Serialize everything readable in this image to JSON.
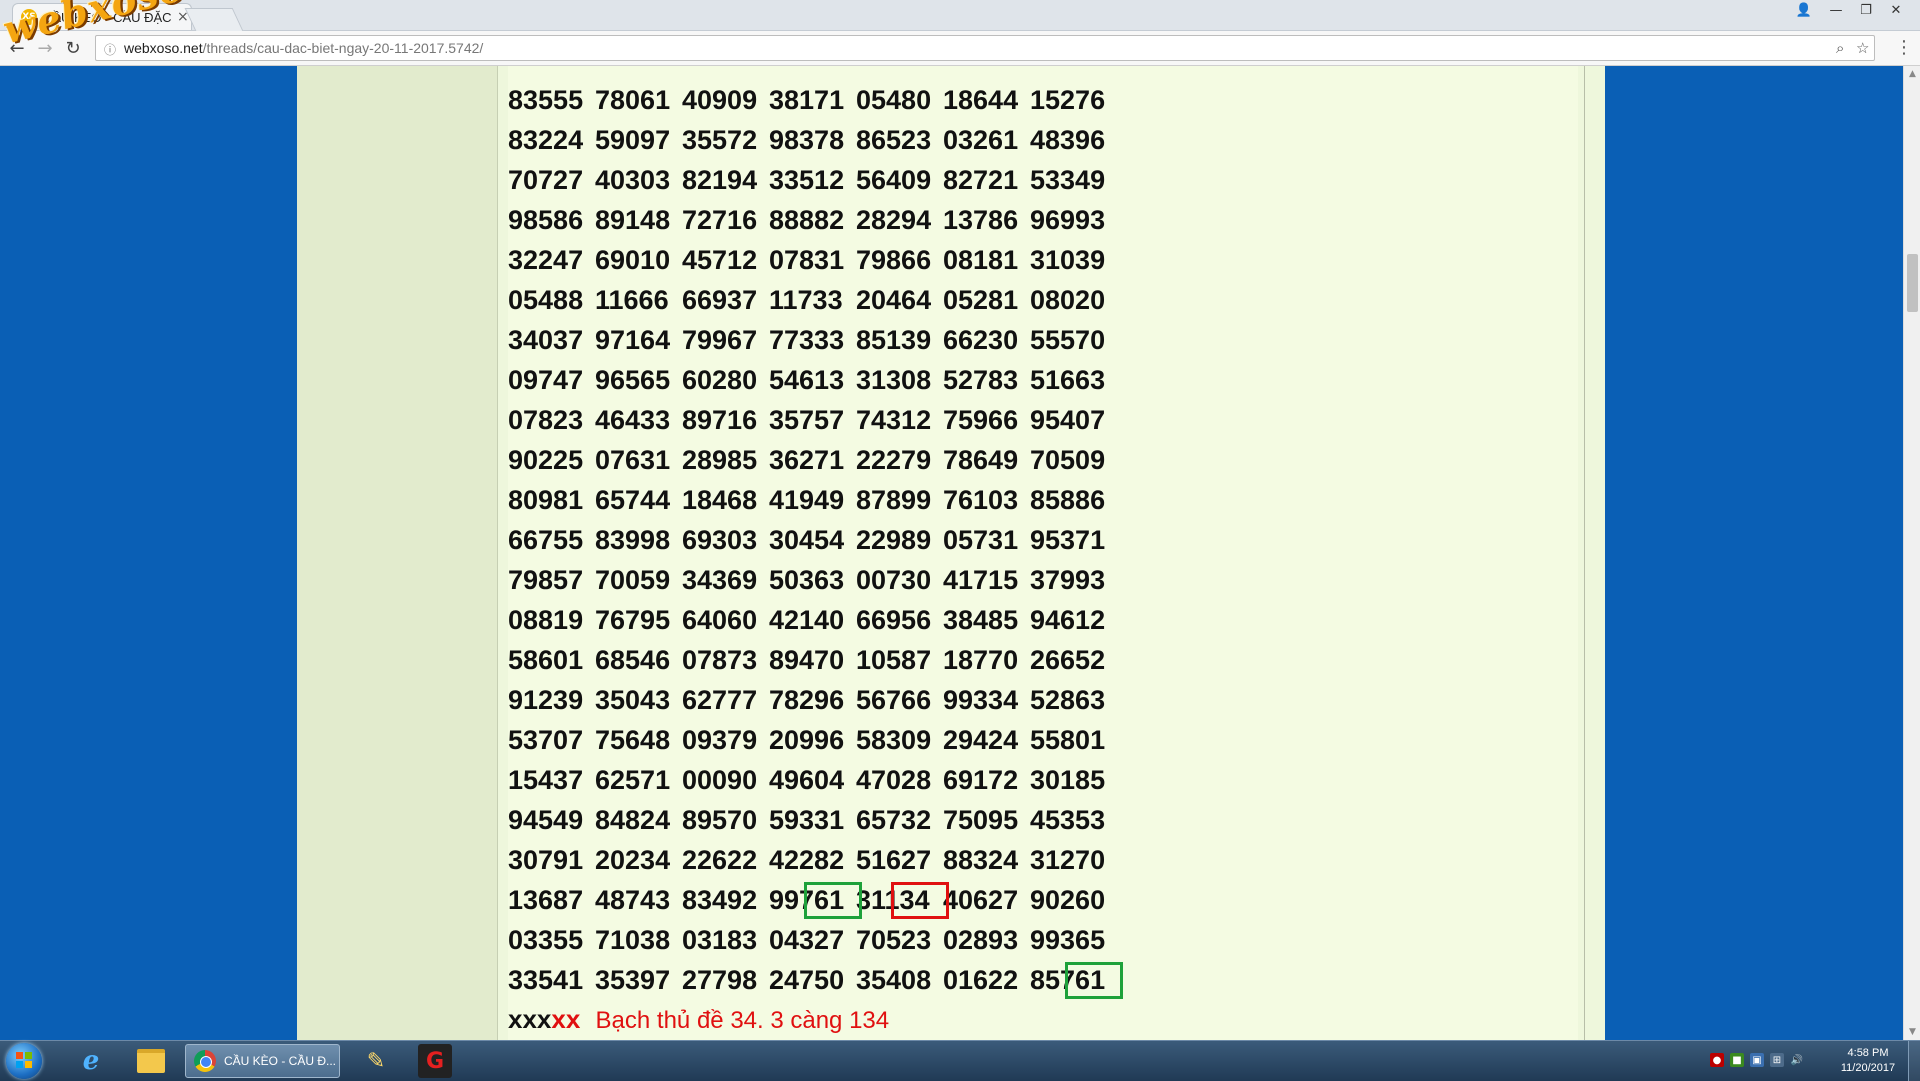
{
  "browser": {
    "tab_title": "CẦU KÈO - CẦU ĐẶC BIỆT",
    "favicon_text": "XS",
    "url_host": "webxoso.net",
    "url_path": "/threads/cau-dac-biet-ngay-20-11-2017.5742/"
  },
  "watermark": "webxoso.net",
  "table": {
    "rows": [
      [
        "83555",
        "78061",
        "40909",
        "38171",
        "05480",
        "18644",
        "15276"
      ],
      [
        "83224",
        "59097",
        "35572",
        "98378",
        "86523",
        "03261",
        "48396"
      ],
      [
        "70727",
        "40303",
        "82194",
        "33512",
        "56409",
        "82721",
        "53349"
      ],
      [
        "98586",
        "89148",
        "72716",
        "88882",
        "28294",
        "13786",
        "96993"
      ],
      [
        "32247",
        "69010",
        "45712",
        "07831",
        "79866",
        "08181",
        "31039"
      ],
      [
        "05488",
        "11666",
        "66937",
        "11733",
        "20464",
        "05281",
        "08020"
      ],
      [
        "34037",
        "97164",
        "79967",
        "77333",
        "85139",
        "66230",
        "55570"
      ],
      [
        "09747",
        "96565",
        "60280",
        "54613",
        "31308",
        "52783",
        "51663"
      ],
      [
        "07823",
        "46433",
        "89716",
        "35757",
        "74312",
        "75966",
        "95407"
      ],
      [
        "90225",
        "07631",
        "28985",
        "36271",
        "22279",
        "78649",
        "70509"
      ],
      [
        "80981",
        "65744",
        "18468",
        "41949",
        "87899",
        "76103",
        "85886"
      ],
      [
        "66755",
        "83998",
        "69303",
        "30454",
        "22989",
        "05731",
        "95371"
      ],
      [
        "79857",
        "70059",
        "34369",
        "50363",
        "00730",
        "41715",
        "37993"
      ],
      [
        "08819",
        "76795",
        "64060",
        "42140",
        "66956",
        "38485",
        "94612"
      ],
      [
        "58601",
        "68546",
        "07873",
        "89470",
        "10587",
        "18770",
        "26652"
      ],
      [
        "91239",
        "35043",
        "62777",
        "78296",
        "56766",
        "99334",
        "52863"
      ],
      [
        "53707",
        "75648",
        "09379",
        "20996",
        "58309",
        "29424",
        "55801"
      ],
      [
        "15437",
        "62571",
        "00090",
        "49604",
        "47028",
        "69172",
        "30185"
      ],
      [
        "94549",
        "84824",
        "89570",
        "59331",
        "65732",
        "75095",
        "45353"
      ],
      [
        "30791",
        "20234",
        "22622",
        "42282",
        "51627",
        "88324",
        "31270"
      ],
      [
        "13687",
        "48743",
        "83492",
        "99761",
        "31134",
        "40627",
        "90260"
      ],
      [
        "03355",
        "71038",
        "03183",
        "04327",
        "70523",
        "02893",
        "99365"
      ],
      [
        "33541",
        "35397",
        "27798",
        "24750",
        "35408",
        "01622",
        "85761"
      ]
    ],
    "highlights": [
      {
        "row": 20,
        "col": 3,
        "color": "#1ea13a"
      },
      {
        "row": 20,
        "col": 4,
        "color": "#e01010"
      },
      {
        "row": 22,
        "col": 6,
        "color": "#1ea13a"
      }
    ]
  },
  "footer": {
    "mask_black": "xxx",
    "mask_red": "xx",
    "note": "Bạch thủ đề 34. 3 càng 134"
  },
  "taskbar": {
    "chrome_label": "CẦU KÈO - CẦU Đ...",
    "clock_time": "4:58 PM",
    "clock_date": "11/20/2017"
  },
  "colors": {
    "page_bg": "#0a5fb5",
    "post_bg": "#f4fbe2",
    "highlight_green": "#1ea13a",
    "highlight_red": "#e01010"
  }
}
